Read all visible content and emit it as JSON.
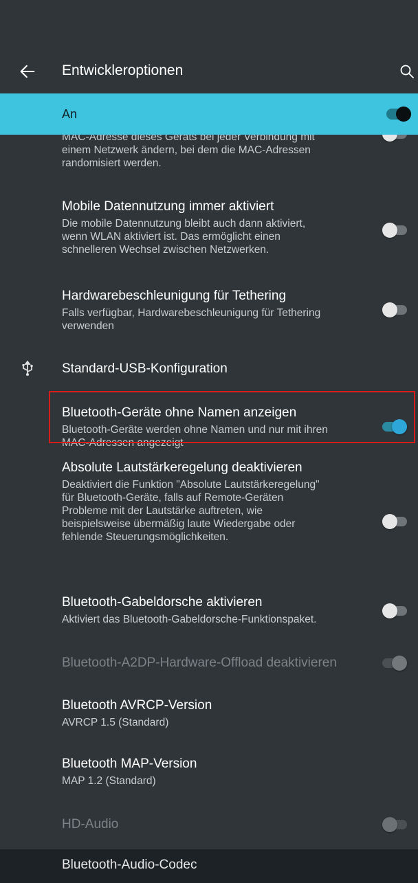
{
  "appbar": {
    "title": "Entwickleroptionen"
  },
  "master": {
    "label": "An",
    "state": "on"
  },
  "items": [
    {
      "summary_lines": [
        "MAC-Adresse dieses Geräts bei jeder Verbindung mit",
        "einem Netzwerk ändern, bei dem die MAC-Adressen",
        "randomisiert werden."
      ],
      "switch": "off"
    },
    {
      "title": "Mobile Datennutzung immer aktiviert",
      "summary_lines": [
        "Die mobile Datennutzung bleibt auch dann aktiviert,",
        "wenn WLAN aktiviert ist. Das ermöglicht einen",
        "schnelleren Wechsel zwischen Netzwerken."
      ],
      "switch": "off"
    },
    {
      "title": "Hardwarebeschleunigung für Tethering",
      "summary_lines": [
        "Falls verfügbar, Hardwarebeschleunigung für Tethering",
        "verwenden"
      ],
      "switch": "off"
    },
    {
      "title": "Standard-USB-Konfiguration",
      "icon": "usb-icon"
    },
    {
      "title": "Bluetooth-Geräte ohne Namen anzeigen",
      "summary_lines": [
        "Bluetooth-Geräte werden ohne Namen und nur mit ihren",
        "MAC-Adressen angezeigt"
      ],
      "switch": "on",
      "highlighted": true
    },
    {
      "title": "Absolute Lautstärkeregelung deaktivieren",
      "summary_lines": [
        "Deaktiviert die Funktion \"Absolute Lautstärkeregelung\"",
        "für Bluetooth-Geräte, falls auf Remote-Geräten",
        "Probleme mit der Lautstärke auftreten, wie",
        "beispielsweise übermäßig laute Wiedergabe oder",
        "fehlende Steuerungsmöglichkeiten."
      ],
      "switch": "off"
    },
    {
      "title": "Bluetooth-Gabeldorsche aktivieren",
      "summary_lines": [
        "Aktiviert das Bluetooth-Gabeldorsche-Funktionspaket."
      ],
      "switch": "off"
    },
    {
      "title": "Bluetooth-A2DP-Hardware-Offload deaktivieren",
      "switch": "on",
      "disabled": true
    },
    {
      "title": "Bluetooth AVRCP-Version",
      "summary_lines": [
        "AVRCP 1.5 (Standard)"
      ]
    },
    {
      "title": "Bluetooth MAP-Version",
      "summary_lines": [
        "MAP 1.2 (Standard)"
      ]
    },
    {
      "title": "HD-Audio",
      "switch": "off",
      "disabled": true
    },
    {
      "title": "Bluetooth-Audio-Codec"
    }
  ],
  "colors": {
    "accent": "#3fc4e0",
    "background": "#2f3539",
    "highlight_border": "#d81b1b",
    "switch_on": "#2ea7d8"
  }
}
